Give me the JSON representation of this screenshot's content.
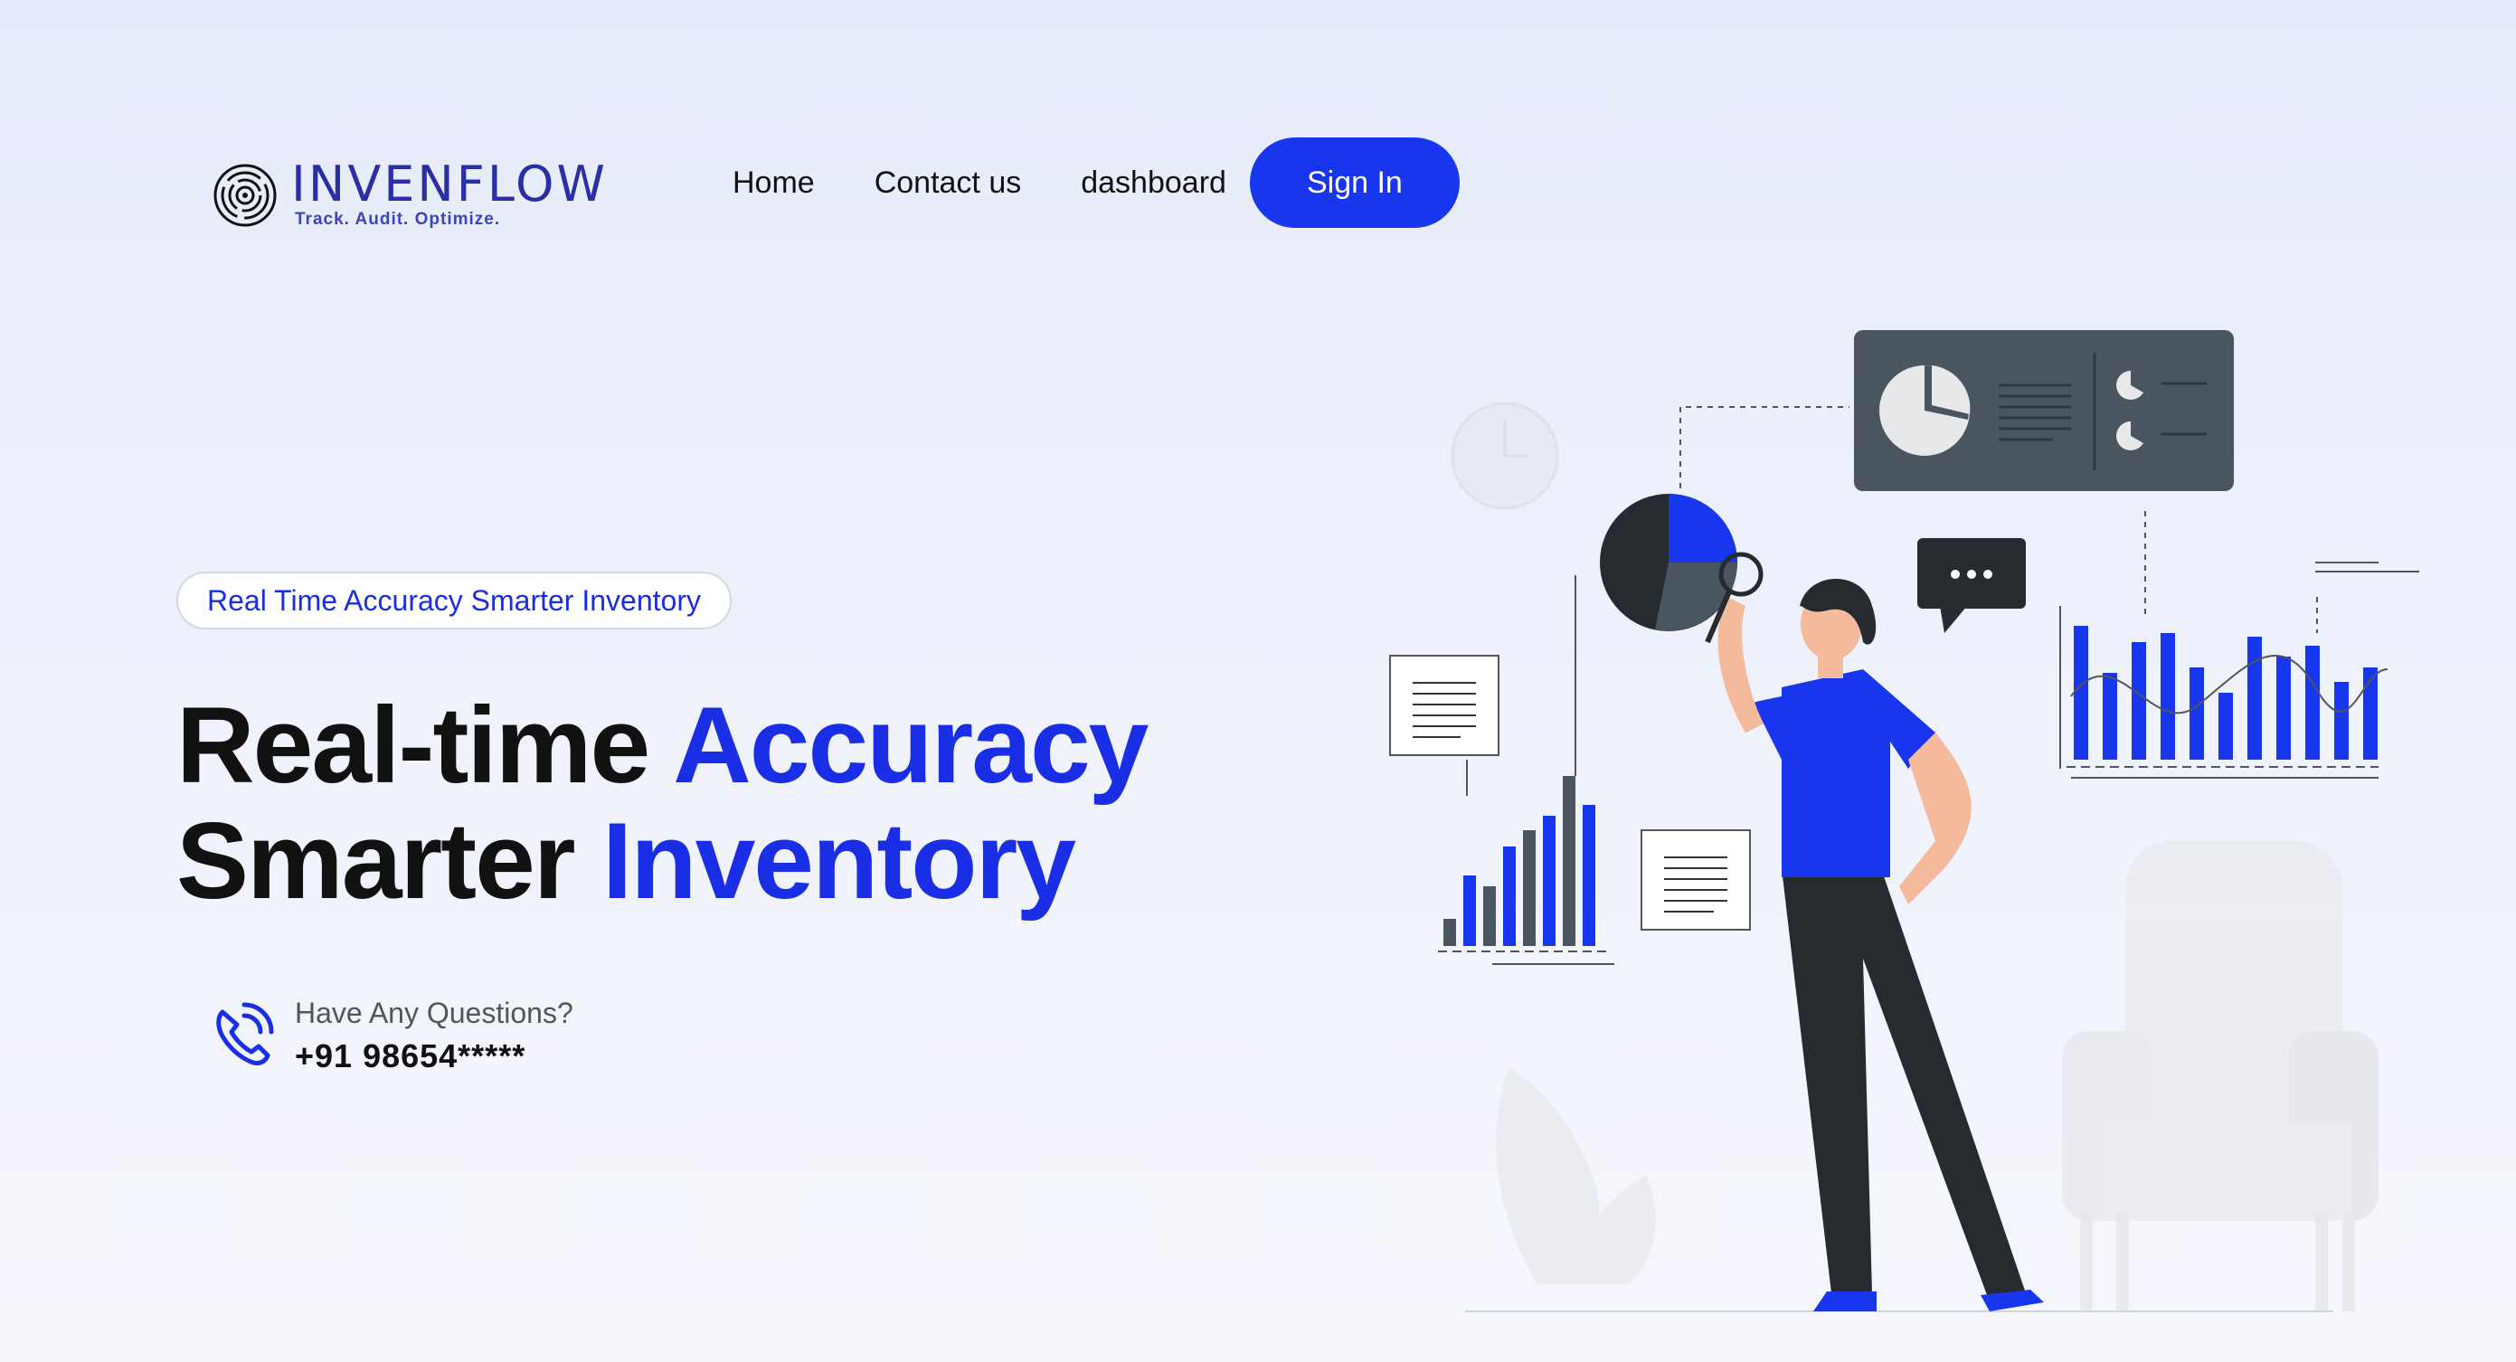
{
  "brand": {
    "name": "INVENFLOW",
    "tagline": "Track. Audit. Optimize."
  },
  "nav": {
    "home": "Home",
    "contact": "Contact us",
    "dashboard": "dashboard",
    "signin": "Sign In"
  },
  "hero": {
    "badge": "Real Time Accuracy Smarter Inventory",
    "line1_dark": "Real-time ",
    "line1_blue": "Accuracy",
    "line2_dark": "Smarter ",
    "line2_blue": "Inventory"
  },
  "contact": {
    "question": "Have Any Questions?",
    "phone": "+91 98654*****"
  },
  "colors": {
    "accent": "#1836ee",
    "dark": "#111111",
    "slate": "#4b5660",
    "logo": "#2a2fa8"
  },
  "icons": {
    "logo": "concentric-target-icon",
    "phone": "phone-ringing-icon"
  }
}
